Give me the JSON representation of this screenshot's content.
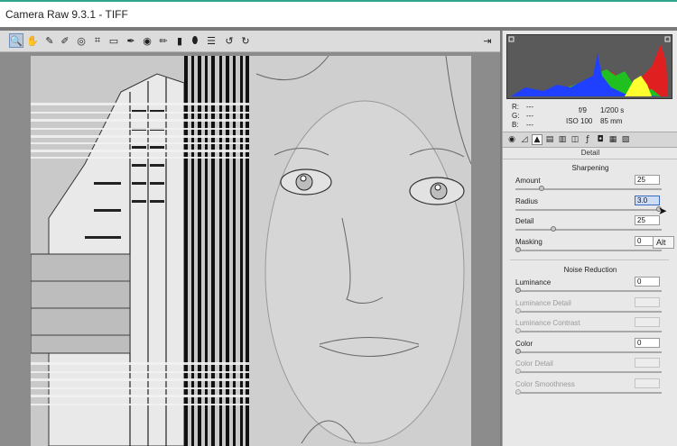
{
  "window": {
    "title": "Camera Raw 9.3.1  -  TIFF"
  },
  "toolbar": {
    "tools": [
      {
        "icon": "zoom-icon",
        "glyph": "🔍"
      },
      {
        "icon": "hand-icon",
        "glyph": "✋"
      },
      {
        "icon": "white-balance-icon",
        "glyph": "✎"
      },
      {
        "icon": "color-sampler-icon",
        "glyph": "✐"
      },
      {
        "icon": "targeted-adjustment-icon",
        "glyph": "◎"
      },
      {
        "icon": "crop-icon",
        "glyph": "⌗"
      },
      {
        "icon": "straighten-icon",
        "glyph": "▭"
      },
      {
        "icon": "spot-removal-icon",
        "glyph": "✒"
      },
      {
        "icon": "red-eye-icon",
        "glyph": "◉"
      },
      {
        "icon": "adjustment-brush-icon",
        "glyph": "✏"
      },
      {
        "icon": "graduated-filter-icon",
        "glyph": "▮"
      },
      {
        "icon": "radial-filter-icon",
        "glyph": "⬮"
      },
      {
        "icon": "preferences-icon",
        "glyph": "☰"
      },
      {
        "icon": "rotate-ccw-icon",
        "glyph": "↺"
      },
      {
        "icon": "rotate-cw-icon",
        "glyph": "↻"
      }
    ],
    "fullscreen_icon": "fullscreen-icon"
  },
  "info": {
    "r_label": "R:",
    "g_label": "G:",
    "b_label": "B:",
    "r_val": "---",
    "g_val": "---",
    "b_val": "---",
    "aperture": "f/9",
    "shutter": "1/200 s",
    "iso": "ISO 100",
    "focal": "85 mm"
  },
  "panel": {
    "title": "Detail",
    "sharpening": {
      "heading": "Sharpening",
      "rows": [
        {
          "label": "Amount",
          "value": "25",
          "level": 0.167
        },
        {
          "label": "Radius",
          "value": "3.0",
          "level": 1.0
        },
        {
          "label": "Detail",
          "value": "25",
          "level": 0.25
        },
        {
          "label": "Masking",
          "value": "0",
          "level": 0
        }
      ]
    },
    "noise": {
      "heading": "Noise Reduction",
      "rows": [
        {
          "label": "Luminance",
          "value": "0",
          "level": 0,
          "enabled": true
        },
        {
          "label": "Luminance Detail",
          "value": "",
          "level": 0,
          "enabled": false
        },
        {
          "label": "Luminance Contrast",
          "value": "",
          "level": 0,
          "enabled": false
        },
        {
          "label": "Color",
          "value": "0",
          "level": 0,
          "enabled": true
        },
        {
          "label": "Color Detail",
          "value": "",
          "level": 0,
          "enabled": false
        },
        {
          "label": "Color Smoothness",
          "value": "",
          "level": 0,
          "enabled": false
        }
      ]
    }
  },
  "tooltip": "Alt",
  "colors": {
    "accent": "#2fa58e",
    "histo_red": "#e02020",
    "histo_green": "#20c020",
    "histo_blue": "#2040ff"
  }
}
